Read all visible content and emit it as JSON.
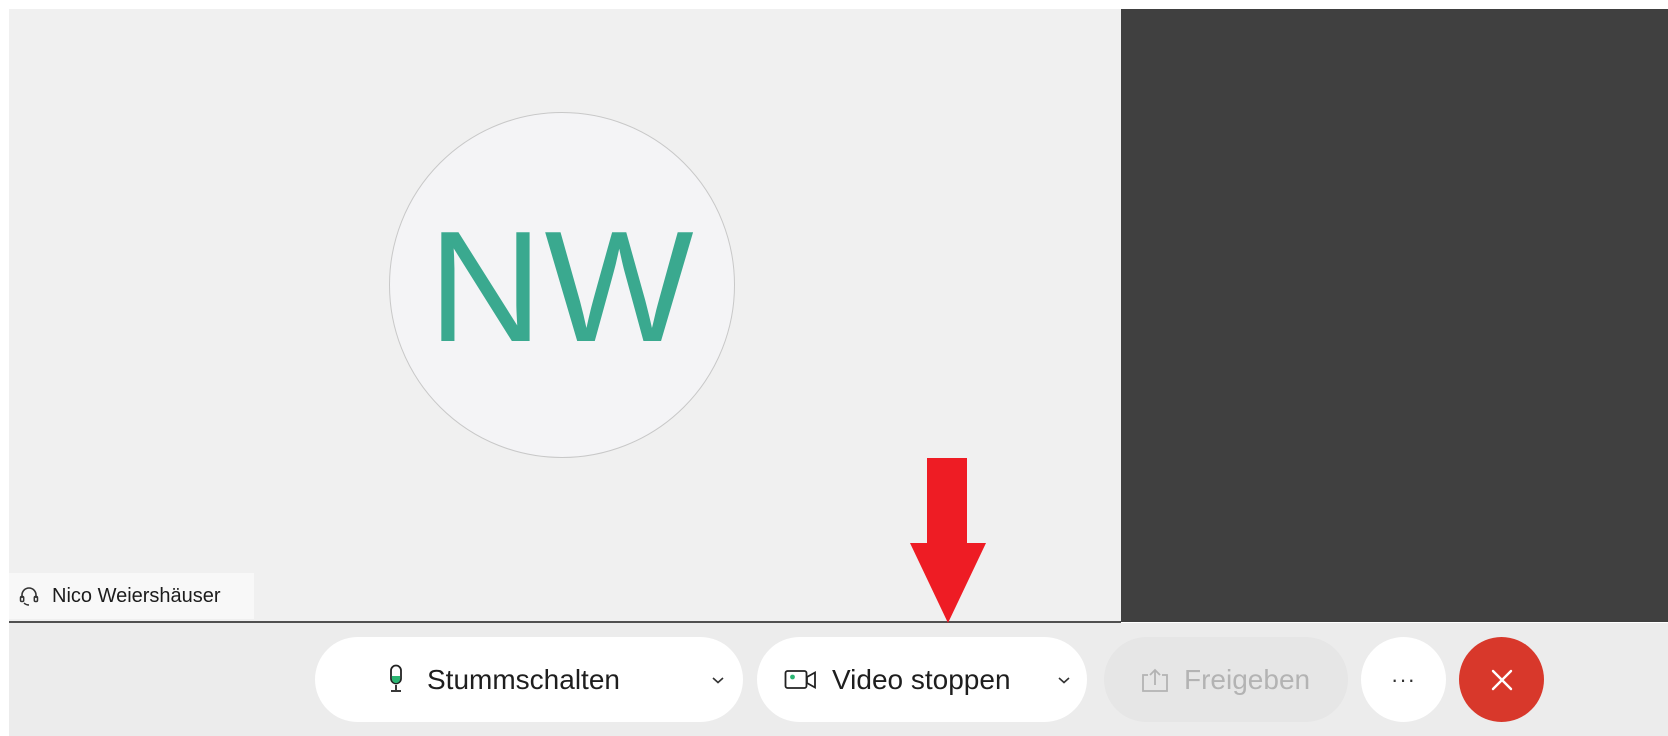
{
  "participant": {
    "initials": "NW",
    "name": "Nico Weiershäuser"
  },
  "toolbar": {
    "mute_label": "Stummschalten",
    "video_label": "Video stoppen",
    "share_label": "Freigeben",
    "more_label": "···"
  },
  "icons": {
    "name_tag": "headset-icon",
    "mute": "microphone-icon",
    "video": "video-camera-icon",
    "share": "share-upload-icon",
    "leave": "close-icon"
  },
  "colors": {
    "avatar_initials": "#3aa98f",
    "leave_button": "#d8382b",
    "mic_level": "#2bb673",
    "annotation_arrow": "#ee1c24"
  }
}
